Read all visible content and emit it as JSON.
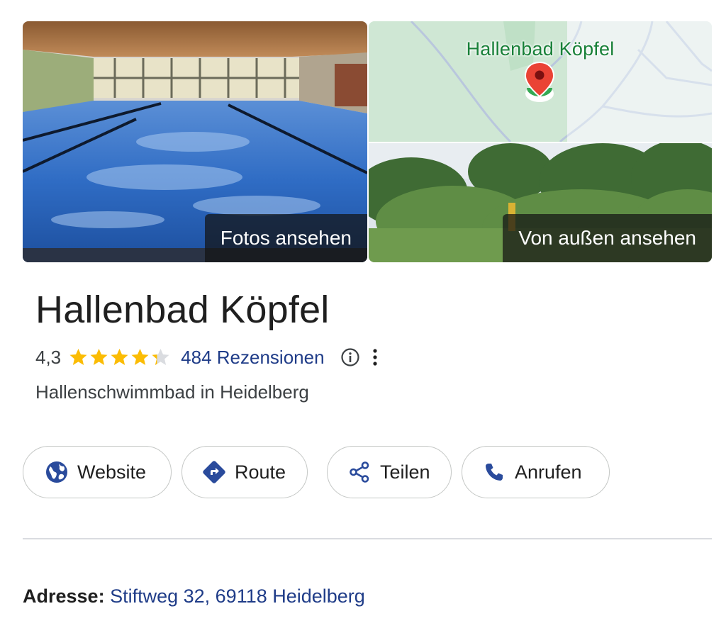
{
  "media": {
    "photos_label": "Fotos ansehen",
    "map_title": "Hallenbad Köpfel",
    "outside_label": "Von außen ansehen"
  },
  "place": {
    "title": "Hallenbad Köpfel",
    "rating": "4,3",
    "rating_stars": 4.3,
    "reviews": "484 Rezensionen",
    "category": "Hallenschwimmbad in Heidelberg"
  },
  "actions": {
    "website": "Website",
    "route": "Route",
    "share": "Teilen",
    "call": "Anrufen"
  },
  "address": {
    "label": "Adresse:",
    "value": "Stiftweg 32, 69118 Heidelberg"
  },
  "colors": {
    "accent_blue": "#1f3c88",
    "star": "#fbbc04",
    "map_pin": "#ea4335",
    "map_green": "#188038"
  },
  "icons": [
    "globe-icon",
    "directions-icon",
    "share-icon",
    "phone-icon",
    "info-icon",
    "more-vert-icon",
    "map-pin-icon",
    "star-icon"
  ]
}
